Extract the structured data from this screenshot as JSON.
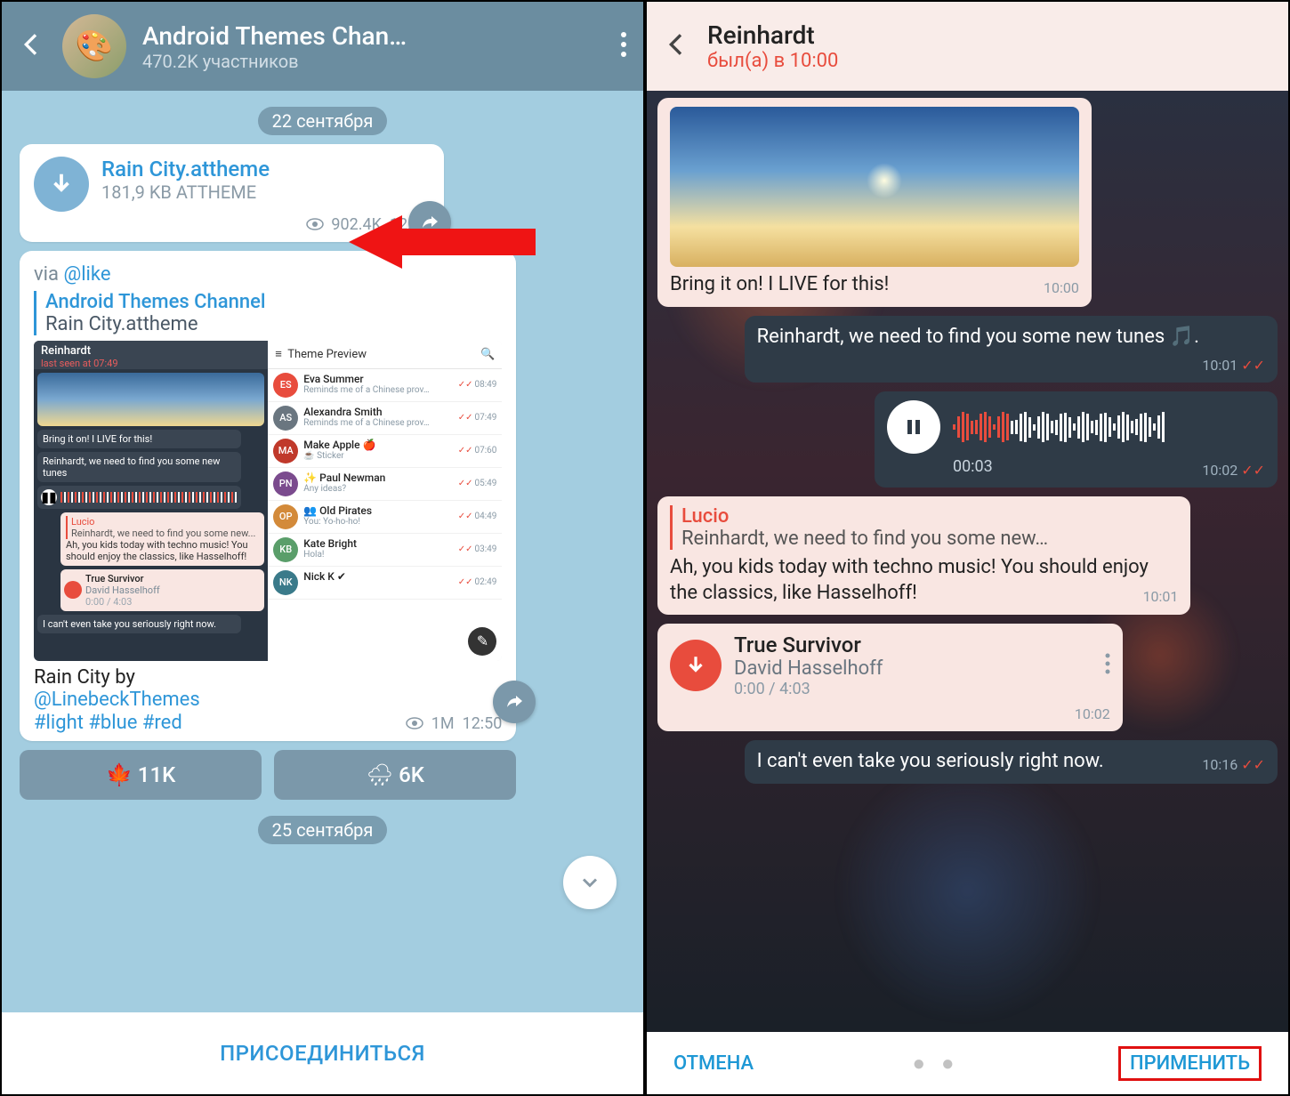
{
  "left": {
    "header": {
      "title": "Android Themes Chan…",
      "subtitle": "470.2K участников"
    },
    "dates": {
      "d1": "22 сентября",
      "d2": "25 сентября"
    },
    "file": {
      "name": "Rain City.attheme",
      "size": "181,9 KB ATTHEME",
      "views": "902.4K",
      "time": "12:49"
    },
    "post": {
      "via_label": "via ",
      "via_handle": "@like",
      "quote_title": "Android Themes Channel",
      "quote_sub": "Rain City.attheme",
      "caption_prefix": "Rain City by",
      "caption_link": "@LinebeckThemes",
      "tags": "#light #blue #red",
      "views": "1M",
      "time": "12:50"
    },
    "preview": {
      "chat_name": "Reinhardt",
      "chat_status": "last seen at 07:49",
      "msg1": "Bring it on! I LIVE for this!",
      "msg2": "Reinhardt, we need to find you some new tunes",
      "reply_name": "Lucio",
      "reply_sub": "Reinhardt, we need to find you some new...",
      "reply_body": "Ah, you kids today with techno music! You should enjoy the classics, like Hasselhoff!",
      "file_name": "True Survivor",
      "file_artist": "David Hasselhoff",
      "file_pos": "0:00 / 4:03",
      "last": "I can't even take you seriously right now.",
      "right_title": "Theme Preview",
      "items": [
        {
          "initials": "ES",
          "color": "#e84c3d",
          "name": "Eva Summer",
          "sub": "Reminds me of a Chinese prov…",
          "time": "08:49"
        },
        {
          "initials": "AS",
          "color": "#6a7680",
          "name": "Alexandra Smith",
          "sub": "Reminds me of a Chinese prov…",
          "time": "07:49"
        },
        {
          "initials": "MA",
          "color": "#c0392b",
          "name": "Make Apple 🍎",
          "sub": "☕ Sticker",
          "time": "07:60"
        },
        {
          "initials": "PN",
          "color": "#7b4b8e",
          "name": "✨ Paul Newman",
          "sub": "Any ideas?",
          "time": "05:49"
        },
        {
          "initials": "OP",
          "color": "#d38a3a",
          "name": "👥 Old Pirates",
          "sub": "You: Yo-ho-ho!",
          "time": "04:49"
        },
        {
          "initials": "KB",
          "color": "#5a9e6a",
          "name": "Kate Bright",
          "sub": "Hola!",
          "time": "03:49"
        },
        {
          "initials": "NK",
          "color": "#3a7a8a",
          "name": "Nick K ✔",
          "sub": "",
          "time": "02:49"
        }
      ]
    },
    "reactions": {
      "r1": "11K",
      "r2": "6K"
    },
    "reaction_emojis": {
      "r1": "🍁",
      "r2": "🌧"
    },
    "join": "ПРИСОЕДИНИТЬСЯ"
  },
  "right": {
    "header": {
      "title": "Reinhardt",
      "subtitle": "был(а) в 10:00"
    },
    "m1": {
      "text": "Bring it on! I LIVE for this!",
      "time": "10:00"
    },
    "m2": {
      "text": "Reinhardt, we need to find you some new tunes 🎵.",
      "time": "10:01"
    },
    "m3": {
      "pos": "00:03",
      "time": "10:02"
    },
    "m4": {
      "reply_name": "Lucio",
      "reply_text": "Reinhardt, we need to find you some new…",
      "text": "Ah, you kids today with techno music! You should enjoy the classics, like Hasselhoff!",
      "time": "10:01"
    },
    "m5": {
      "song": "True Survivor",
      "artist": "David Hasselhoff",
      "pos": "0:00 / 4:03",
      "time": "10:02"
    },
    "m6": {
      "text": "I can't even take you seriously right now.",
      "time": "10:16"
    },
    "footer": {
      "cancel": "ОТМЕНА",
      "apply": "ПРИМЕНИТЬ"
    }
  }
}
